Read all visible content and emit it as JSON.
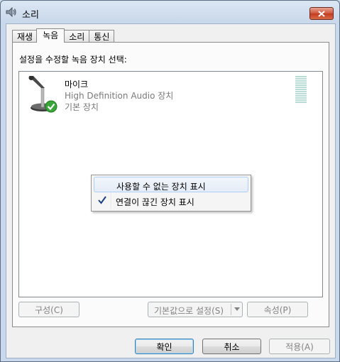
{
  "window": {
    "title": "소리",
    "icon": "speaker-icon"
  },
  "tabs": [
    {
      "label": "재생",
      "active": false
    },
    {
      "label": "녹음",
      "active": true
    },
    {
      "label": "소리",
      "active": false
    },
    {
      "label": "통신",
      "active": false
    }
  ],
  "panel": {
    "prompt": "설정을 수정할 녹음 장치 선택:",
    "device": {
      "name": "마이크",
      "description": "High Definition Audio 장치",
      "status": "기본 장치",
      "icon": "microphone-icon",
      "badge_icon": "default-check-icon"
    }
  },
  "context_menu": {
    "items": [
      {
        "label": "사용할 수 없는 장치 표시",
        "checked": false
      },
      {
        "label": "연결이 끊긴 장치 표시",
        "checked": true
      }
    ]
  },
  "panel_buttons": {
    "configure": "구성(C)",
    "set_default": "기본값으로 설정(S)",
    "properties": "속성(P)"
  },
  "dialog_buttons": {
    "ok": "확인",
    "cancel": "취소",
    "apply": "적용(A)"
  }
}
